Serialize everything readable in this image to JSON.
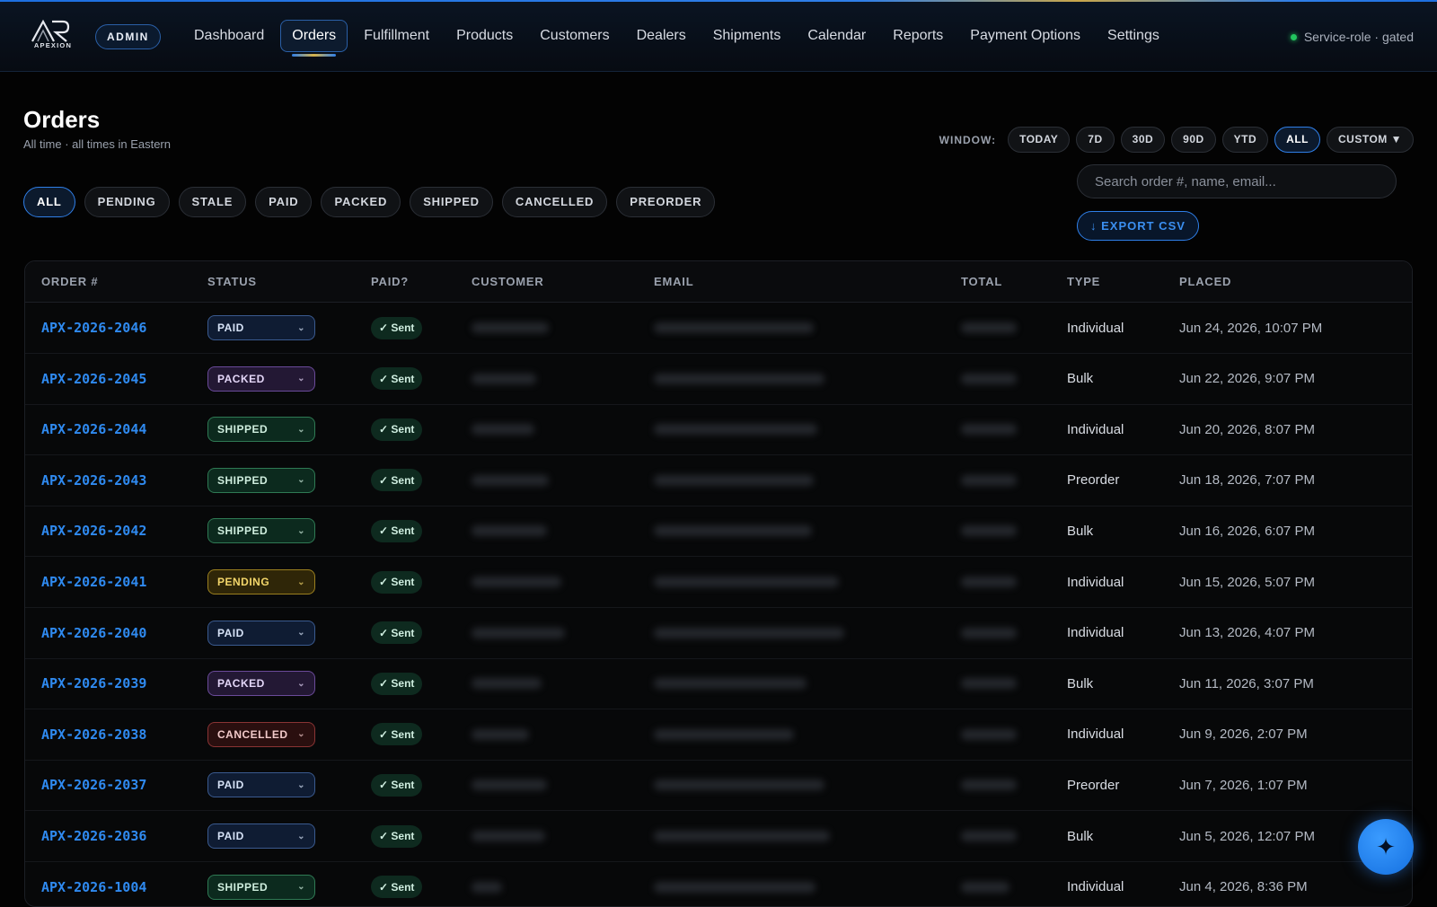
{
  "app": {
    "brand_name": "APEXION",
    "admin_badge": "ADMIN",
    "service_status": "Service-role · gated"
  },
  "nav": [
    {
      "label": "Dashboard",
      "active": false
    },
    {
      "label": "Orders",
      "active": true
    },
    {
      "label": "Fulfillment",
      "active": false
    },
    {
      "label": "Products",
      "active": false
    },
    {
      "label": "Customers",
      "active": false
    },
    {
      "label": "Dealers",
      "active": false
    },
    {
      "label": "Shipments",
      "active": false
    },
    {
      "label": "Calendar",
      "active": false
    },
    {
      "label": "Reports",
      "active": false
    },
    {
      "label": "Payment Options",
      "active": false
    },
    {
      "label": "Settings",
      "active": false
    }
  ],
  "page": {
    "title": "Orders",
    "subtitle": "All time · all times in Eastern"
  },
  "window": {
    "label": "WINDOW:",
    "options": [
      "TODAY",
      "7D",
      "30D",
      "90D",
      "YTD",
      "ALL",
      "CUSTOM ▼"
    ],
    "selected": "ALL"
  },
  "search": {
    "placeholder": "Search order #, name, email...",
    "value": ""
  },
  "export_label": "↓ EXPORT CSV",
  "filters": {
    "options": [
      "ALL",
      "PENDING",
      "STALE",
      "PAID",
      "PACKED",
      "SHIPPED",
      "CANCELLED",
      "PREORDER"
    ],
    "selected": "ALL"
  },
  "table": {
    "columns": [
      "ORDER #",
      "STATUS",
      "PAID?",
      "CUSTOMER",
      "EMAIL",
      "TOTAL",
      "TYPE",
      "PLACED"
    ],
    "status_colors": {
      "PAID": {
        "bg": "#0f1c33",
        "border": "#3a5a8f",
        "text": "#d6e2f6"
      },
      "PACKED": {
        "bg": "#231834",
        "border": "#6a4a99",
        "text": "#e3d6f7"
      },
      "SHIPPED": {
        "bg": "#0c2a1e",
        "border": "#2f7a54",
        "text": "#cfeede"
      },
      "PENDING": {
        "bg": "#2f2608",
        "border": "#9a7f1f",
        "text": "#f3d66a"
      },
      "CANCELLED": {
        "bg": "#2a0f0f",
        "border": "#8a3434",
        "text": "#f1c9c9"
      }
    },
    "rows": [
      {
        "order": "APX-2026-2046",
        "status": "PAID",
        "paid": "✓ Sent",
        "type": "Individual",
        "placed": "Jun 24, 2026, 10:07 PM"
      },
      {
        "order": "APX-2026-2045",
        "status": "PACKED",
        "paid": "✓ Sent",
        "type": "Bulk",
        "placed": "Jun 22, 2026, 9:07 PM"
      },
      {
        "order": "APX-2026-2044",
        "status": "SHIPPED",
        "paid": "✓ Sent",
        "type": "Individual",
        "placed": "Jun 20, 2026, 8:07 PM"
      },
      {
        "order": "APX-2026-2043",
        "status": "SHIPPED",
        "paid": "✓ Sent",
        "type": "Preorder",
        "placed": "Jun 18, 2026, 7:07 PM"
      },
      {
        "order": "APX-2026-2042",
        "status": "SHIPPED",
        "paid": "✓ Sent",
        "type": "Bulk",
        "placed": "Jun 16, 2026, 6:07 PM"
      },
      {
        "order": "APX-2026-2041",
        "status": "PENDING",
        "paid": "✓ Sent",
        "type": "Individual",
        "placed": "Jun 15, 2026, 5:07 PM"
      },
      {
        "order": "APX-2026-2040",
        "status": "PAID",
        "paid": "✓ Sent",
        "type": "Individual",
        "placed": "Jun 13, 2026, 4:07 PM"
      },
      {
        "order": "APX-2026-2039",
        "status": "PACKED",
        "paid": "✓ Sent",
        "type": "Bulk",
        "placed": "Jun 11, 2026, 3:07 PM"
      },
      {
        "order": "APX-2026-2038",
        "status": "CANCELLED",
        "paid": "✓ Sent",
        "type": "Individual",
        "placed": "Jun 9, 2026, 2:07 PM"
      },
      {
        "order": "APX-2026-2037",
        "status": "PAID",
        "paid": "✓ Sent",
        "type": "Preorder",
        "placed": "Jun 7, 2026, 1:07 PM"
      },
      {
        "order": "APX-2026-2036",
        "status": "PAID",
        "paid": "✓ Sent",
        "type": "Bulk",
        "placed": "Jun 5, 2026, 12:07 PM"
      },
      {
        "order": "APX-2026-1004",
        "status": "SHIPPED",
        "paid": "✓ Sent",
        "type": "Individual",
        "placed": "Jun 4, 2026, 8:36 PM"
      }
    ]
  },
  "fab_icon": "sparkle-icon",
  "accent_color": "#2f7fe8"
}
